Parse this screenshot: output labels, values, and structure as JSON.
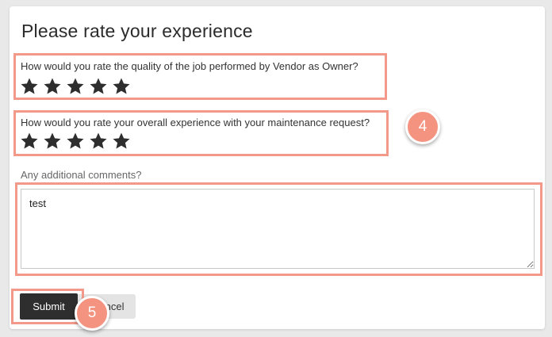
{
  "form": {
    "title": "Please rate your experience",
    "questions": [
      {
        "label": "How would you rate the quality of the job performed by Vendor as Owner?",
        "rating": 5,
        "max_rating": 5
      },
      {
        "label": "How would you rate your overall experience with your maintenance request?",
        "rating": 5,
        "max_rating": 5
      }
    ],
    "comments_label": "Any additional comments?",
    "comments_value": "test",
    "submit_label": "Submit",
    "cancel_label": "Cancel"
  },
  "annotations": {
    "step_4": "4",
    "step_5": "5",
    "highlight_color": "#f2998a",
    "badge_color": "#f4937f"
  },
  "colors": {
    "star": "#2e2e2e",
    "submit_bg": "#2e2e2e",
    "cancel_bg": "#e4e4e4"
  },
  "icons": {
    "rating_star": "star-icon"
  }
}
